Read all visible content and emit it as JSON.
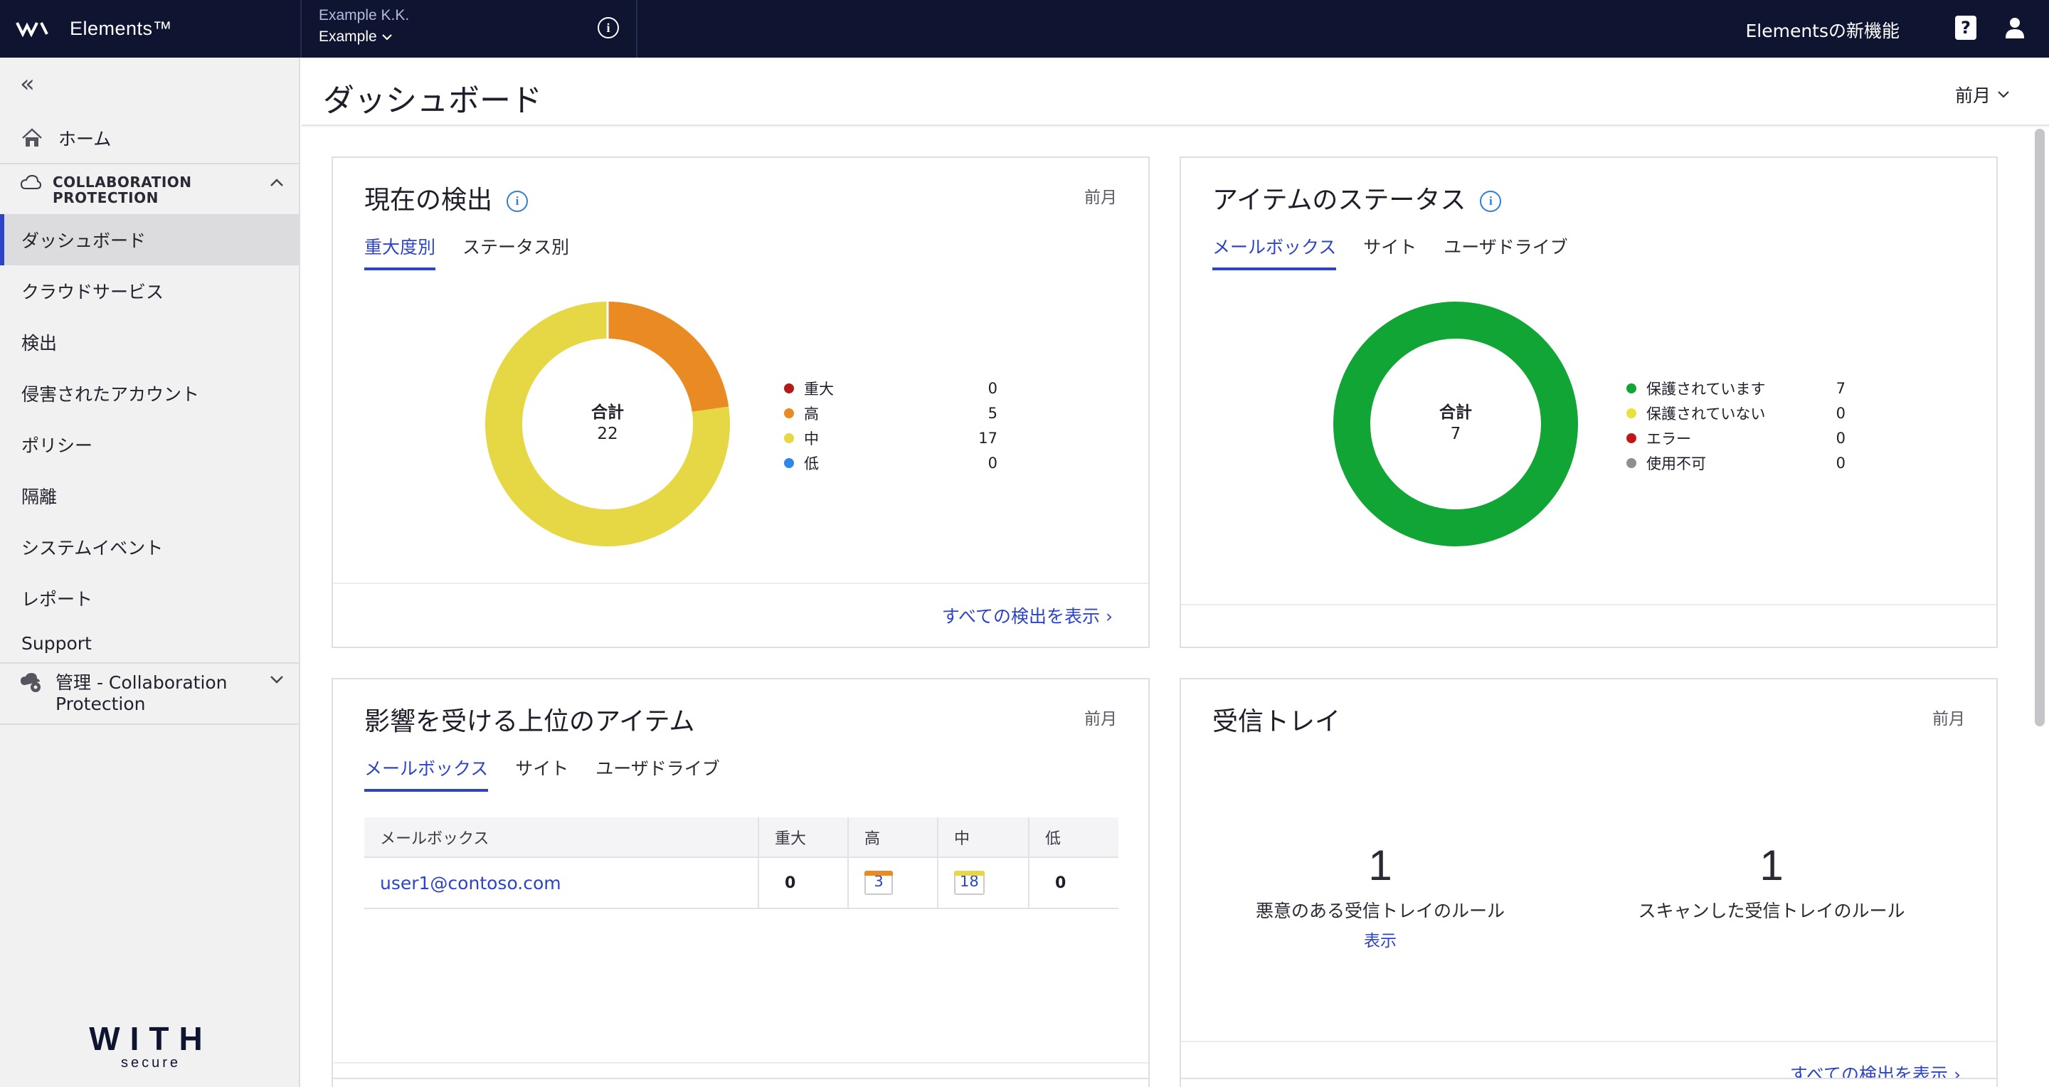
{
  "topbar": {
    "brand": "Elements™",
    "company": "Example K.K.",
    "organization": "Example",
    "whats_new": "Elementsの新機能"
  },
  "sidebar": {
    "home": "ホーム",
    "section": "COLLABORATION PROTECTION",
    "items": [
      {
        "label": "ダッシュボード",
        "active": true
      },
      {
        "label": "クラウドサービス"
      },
      {
        "label": "検出"
      },
      {
        "label": "侵害されたアカウント"
      },
      {
        "label": "ポリシー"
      },
      {
        "label": "隔離"
      },
      {
        "label": "システムイベント"
      },
      {
        "label": "レポート"
      },
      {
        "label": "Support"
      }
    ],
    "admin": "管理 - Collaboration Protection",
    "footer_logo_big": "WITH",
    "footer_logo_small": "secure"
  },
  "page": {
    "title": "ダッシュボード",
    "period": "前月"
  },
  "colors": {
    "critical": "#b31b1b",
    "high": "#ea8a23",
    "medium": "#e6d844",
    "low": "#2f86e8",
    "protected": "#10a535",
    "unprotected": "#e8e23c",
    "error": "#c01818",
    "unavailable": "#8e8e94",
    "accent": "#2d44c4"
  },
  "current_detections": {
    "title": "現在の検出",
    "period": "前月",
    "tabs": [
      "重大度別",
      "ステータス別"
    ],
    "total_label": "合計",
    "total": "22",
    "legend": [
      {
        "label": "重大",
        "value": "0",
        "color_key": "critical"
      },
      {
        "label": "高",
        "value": "5",
        "color_key": "high"
      },
      {
        "label": "中",
        "value": "17",
        "color_key": "medium"
      },
      {
        "label": "低",
        "value": "0",
        "color_key": "low"
      }
    ],
    "footer_link": "すべての検出を表示 ›"
  },
  "item_status": {
    "title": "アイテムのステータス",
    "tabs": [
      "メールボックス",
      "サイト",
      "ユーザドライブ"
    ],
    "total_label": "合計",
    "total": "7",
    "legend": [
      {
        "label": "保護されています",
        "value": "7",
        "color_key": "protected"
      },
      {
        "label": "保護されていない",
        "value": "0",
        "color_key": "unprotected"
      },
      {
        "label": "エラー",
        "value": "0",
        "color_key": "error"
      },
      {
        "label": "使用不可",
        "value": "0",
        "color_key": "unavailable"
      }
    ]
  },
  "top_items": {
    "title": "影響を受ける上位のアイテム",
    "period": "前月",
    "tabs": [
      "メールボックス",
      "サイト",
      "ユーザドライブ"
    ],
    "columns": [
      "メールボックス",
      "重大",
      "高",
      "中",
      "低"
    ],
    "rows": [
      {
        "mailbox": "user1@contoso.com",
        "critical": "0",
        "high": "3",
        "medium": "18",
        "low": "0"
      }
    ]
  },
  "inbox": {
    "title": "受信トレイ",
    "period": "前月",
    "malicious_count": "1",
    "malicious_label": "悪意のある受信トレイのルール",
    "malicious_link": "表示",
    "scanned_count": "1",
    "scanned_label": "スキャンした受信トレイのルール",
    "footer_link": "すべての検出を表示 ›"
  }
}
